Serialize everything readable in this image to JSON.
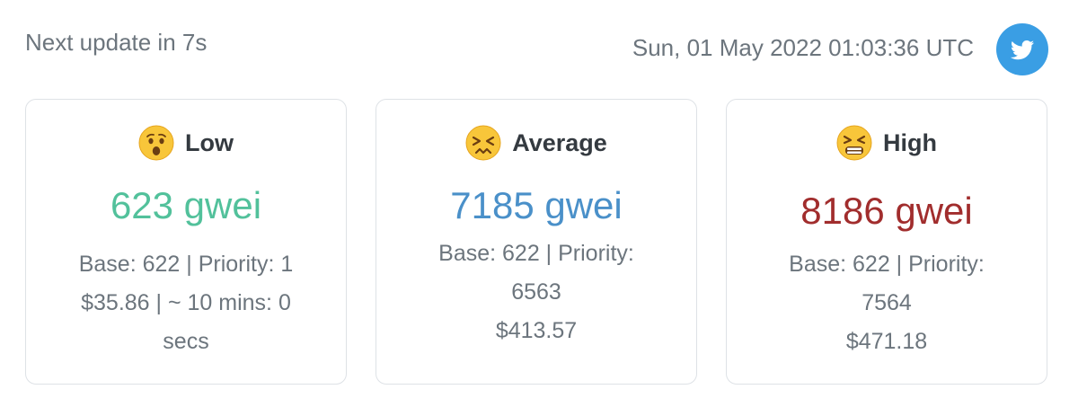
{
  "header": {
    "next_update": "Next update in 7s",
    "timestamp": "Sun, 01 May 2022 01:03:36 UTC",
    "twitter_icon": "twitter-bird-icon",
    "twitter_color": "#3a9ee4"
  },
  "cards": [
    {
      "label": "Low",
      "emoji": "surprised-face-icon",
      "price": "623 gwei",
      "color": "#52c19b",
      "lines": [
        "Base: 622 | Priority: 1",
        "$35.86 | ~ 10 mins: 0",
        "secs"
      ]
    },
    {
      "label": "Average",
      "emoji": "confounded-face-icon",
      "price": "7185 gwei",
      "color": "#4a90c9",
      "lines": [
        "Base: 622 | Priority:",
        "6563",
        "$413.57"
      ]
    },
    {
      "label": "High",
      "emoji": "tired-face-icon",
      "price": "8186 gwei",
      "color": "#a12d2d",
      "lines": [
        "Base: 622 | Priority:",
        "7564",
        "$471.18"
      ]
    }
  ]
}
